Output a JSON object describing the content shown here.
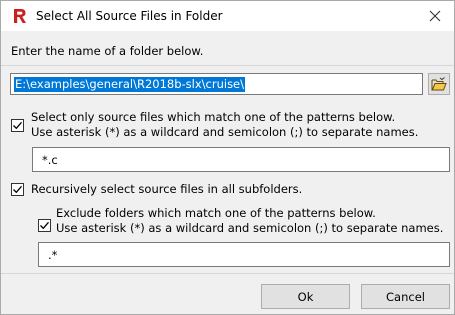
{
  "window": {
    "title": "Select All Source Files in Folder"
  },
  "prompt": "Enter the name of a folder below.",
  "folder": {
    "value": "E:\\examples\\general\\R2018b-slx\\cruise\\"
  },
  "source_filter": {
    "checked": true,
    "label_line1": "Select only source files which match one of the patterns below.",
    "label_line2": "Use asterisk (*) as a wildcard and semicolon (;) to separate names.",
    "value": "*.c"
  },
  "recursive": {
    "checked": true,
    "label": "Recursively select source files in all subfolders."
  },
  "exclude_filter": {
    "checked": true,
    "label_line1": "Exclude folders which match one of the patterns below.",
    "label_line2": "Use asterisk (*) as a wildcard and semicolon (;) to separate names.",
    "value": ".*"
  },
  "buttons": {
    "ok": "Ok",
    "cancel": "Cancel"
  },
  "colors": {
    "accent": "#0078d7",
    "app_icon": "#cc1f1f"
  }
}
